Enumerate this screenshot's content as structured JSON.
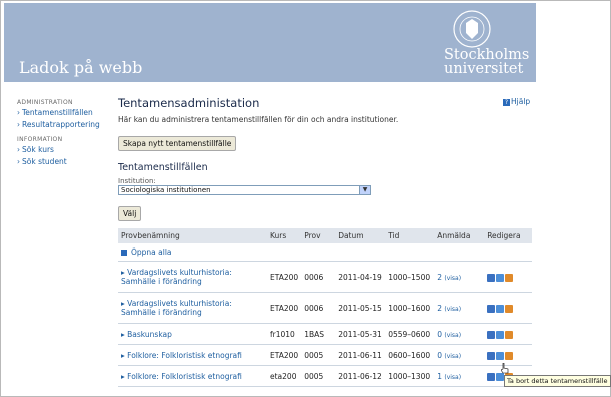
{
  "header": {
    "app_title": "Ladok på webb",
    "uni_line1": "Stockholms",
    "uni_line2": "universitet"
  },
  "sidebar": {
    "sections": [
      {
        "heading": "ADMINISTRATION",
        "items": [
          "Tentamenstillfällen",
          "Resultatrapportering"
        ]
      },
      {
        "heading": "INFORMATION",
        "items": [
          "Sök kurs",
          "Sök student"
        ]
      }
    ]
  },
  "help_label": "Hjälp",
  "main": {
    "title": "Tentamensadministation",
    "intro": "Här kan du administrera tentamenstillfällen för din och andra institutioner.",
    "create_button": "Skapa nytt tentamenstillfälle",
    "section_title": "Tentamenstillfällen",
    "institution_label": "Institution:",
    "institution_value": "Sociologiska institutionen",
    "choose_button": "Välj"
  },
  "table": {
    "headers": [
      "Provbenämning",
      "Kurs",
      "Prov",
      "Datum",
      "Tid",
      "Anmälda",
      "Redigera"
    ],
    "open_all": "Öppna alla",
    "rows": [
      {
        "name": "Vardagslivets kulturhistoria: Samhälle i förändring",
        "kurs": "ETA200",
        "prov": "0006",
        "datum": "2011-04-19",
        "tid": "1000–1500",
        "count": "2",
        "vis": "(visa)"
      },
      {
        "name": "Vardagslivets kulturhistoria: Samhälle i förändring",
        "kurs": "ETA200",
        "prov": "0006",
        "datum": "2011-05-15",
        "tid": "1000–1600",
        "count": "2",
        "vis": "(visa)"
      },
      {
        "name": "Baskunskap",
        "kurs": "fr1010",
        "prov": "1BAS",
        "datum": "2011-05-31",
        "tid": "0559–0600",
        "count": "0",
        "vis": "(visa)"
      },
      {
        "name": "Folklore: Folkloristisk etnografi",
        "kurs": "ETA200",
        "prov": "0005",
        "datum": "2011-06-11",
        "tid": "0600–1600",
        "count": "0",
        "vis": "(visa)"
      },
      {
        "name": "Folklore: Folkloristisk etnografi",
        "kurs": "eta200",
        "prov": "0005",
        "datum": "2011-06-12",
        "tid": "1000–1300",
        "count": "1",
        "vis": "(visa)"
      }
    ]
  },
  "tooltip": "Ta bort detta tentamenstillfälle",
  "icons": [
    "info-icon",
    "edit-icon",
    "delete-icon"
  ]
}
